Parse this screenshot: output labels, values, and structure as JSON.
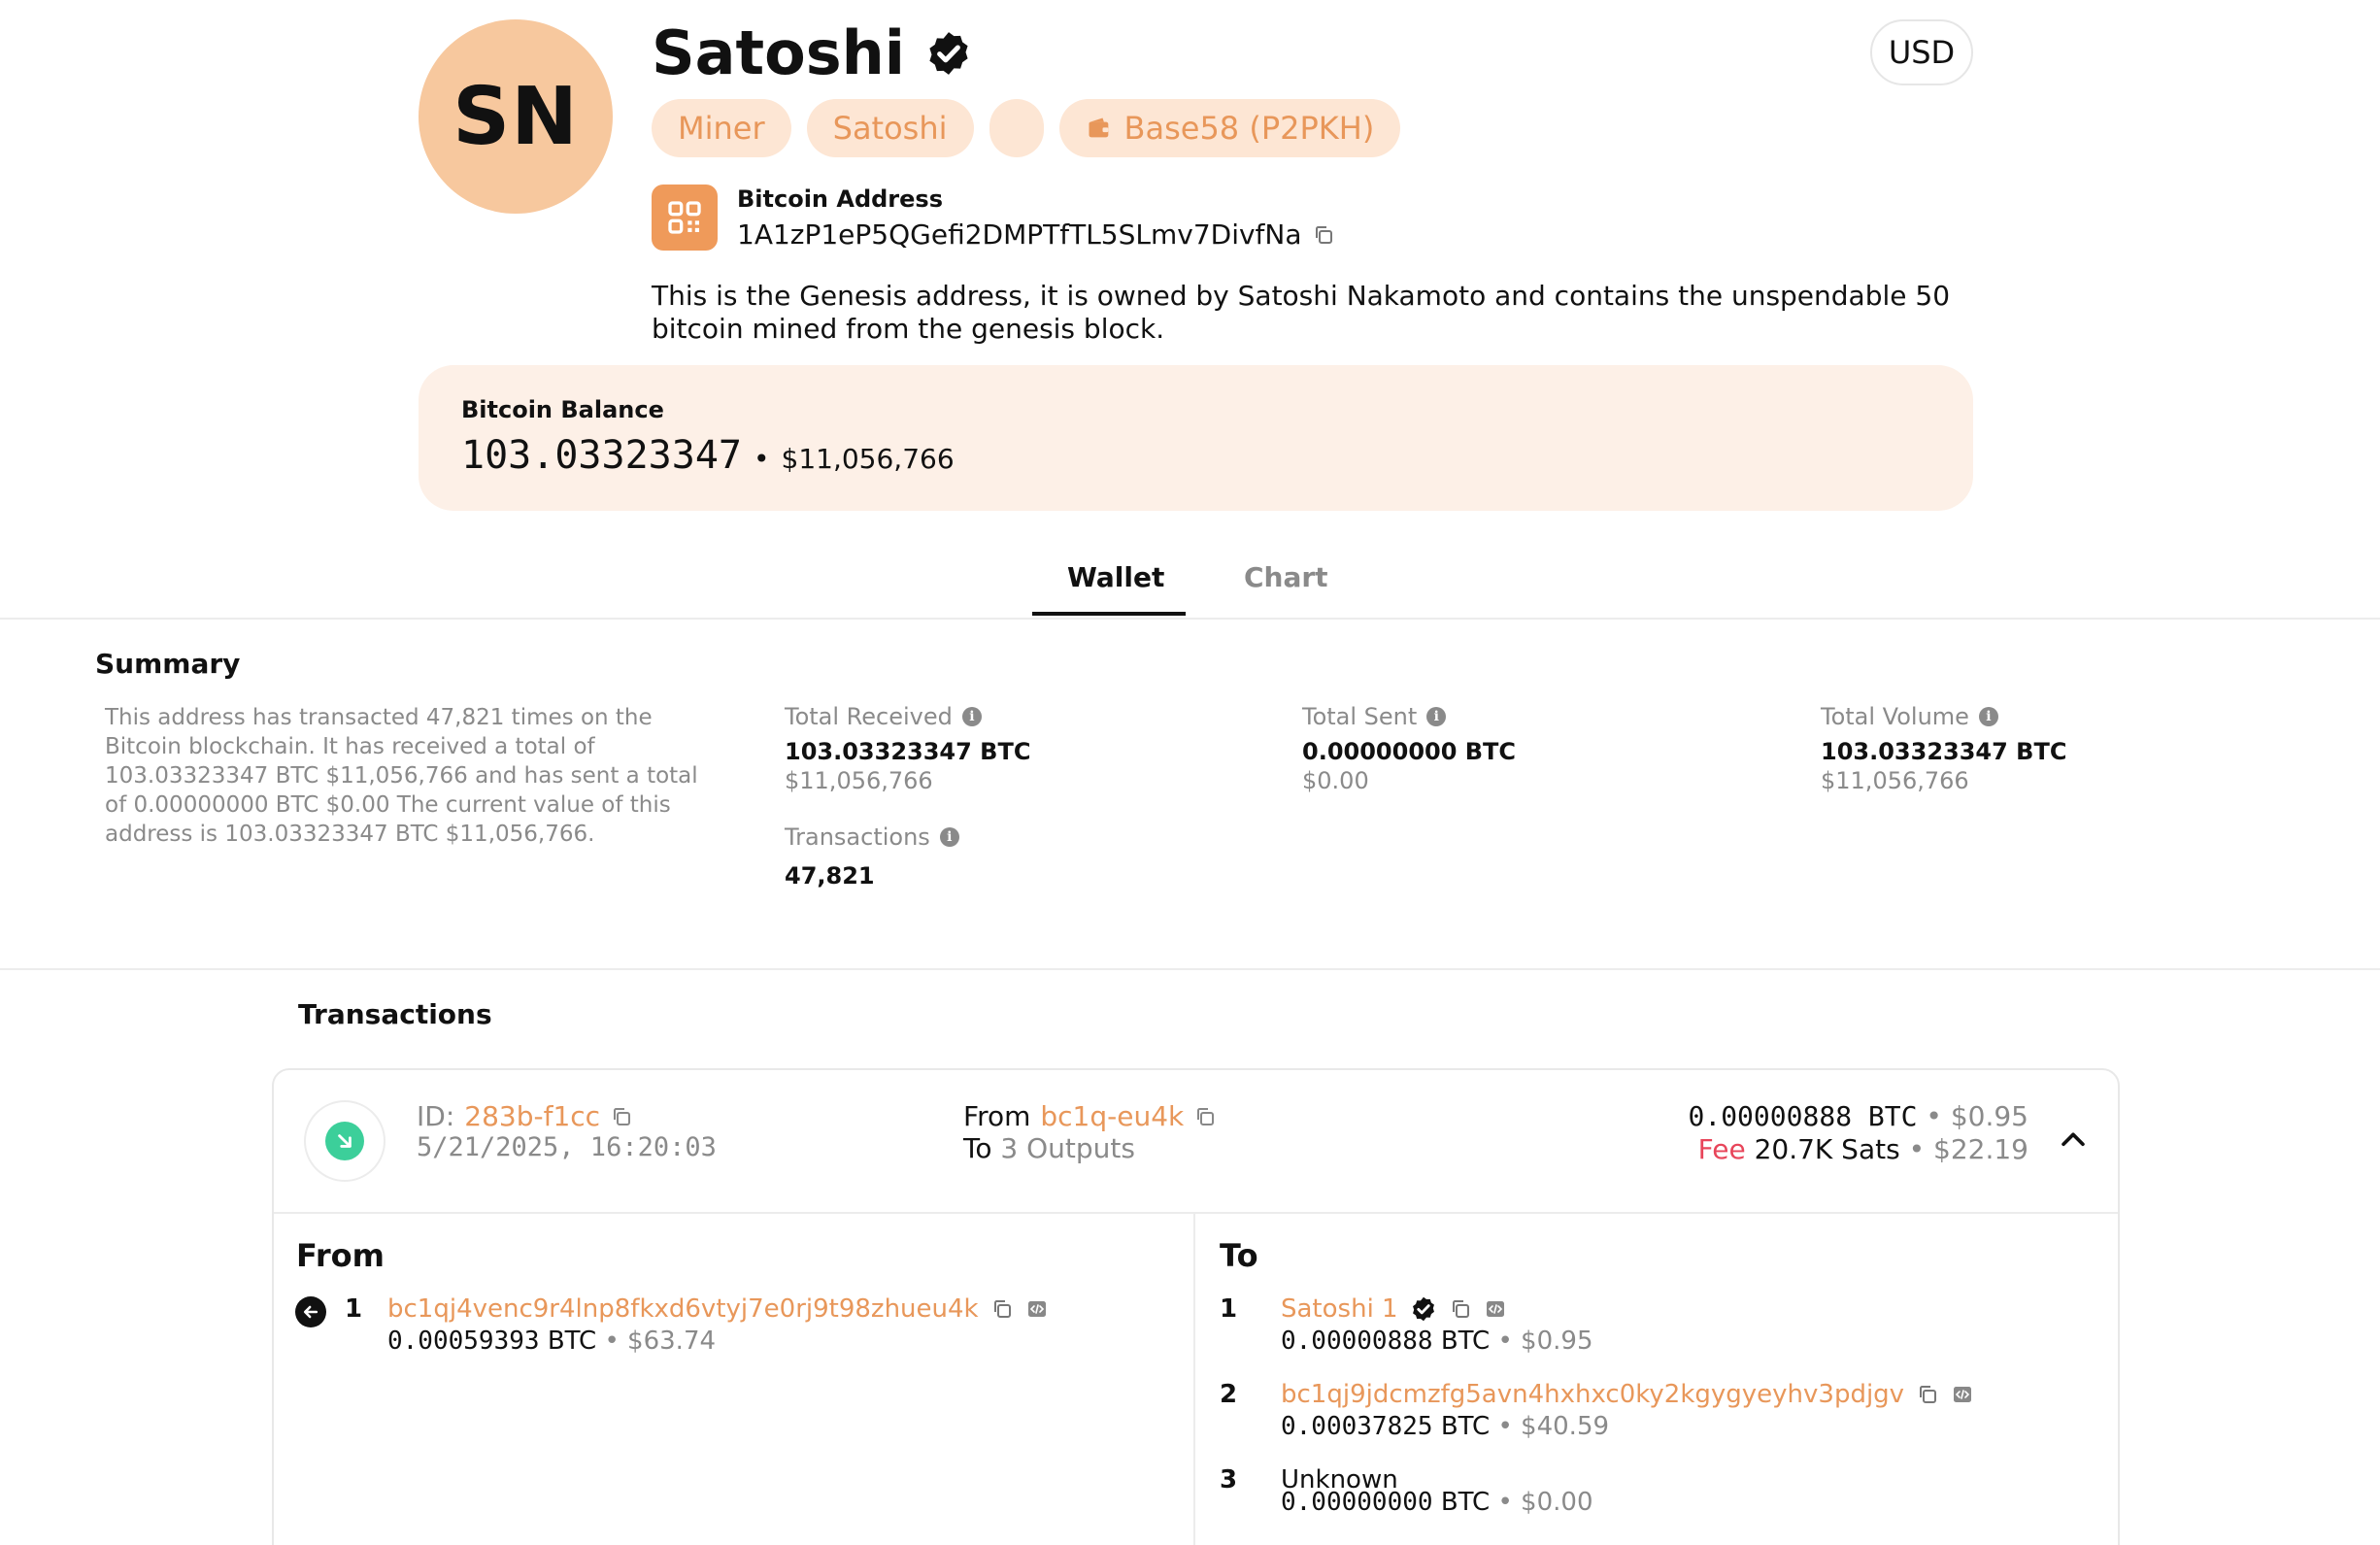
{
  "profile": {
    "initials": "SN",
    "name": "Satoshi",
    "currency": "USD",
    "tags": [
      "Miner",
      "Satoshi",
      "",
      "Base58 (P2PKH)"
    ],
    "address_label": "Bitcoin Address",
    "address": "1A1zP1eP5QGefi2DMPTfTL5SLmv7DivfNa",
    "description": "This is the Genesis address, it is owned by Satoshi Nakamoto and contains the unspendable 50 bitcoin mined from the genesis block."
  },
  "balance": {
    "label": "Bitcoin Balance",
    "btc": "103.03323347",
    "separator": "•",
    "usd": "$11,056,766"
  },
  "tabs": [
    {
      "label": "Wallet",
      "active": true
    },
    {
      "label": "Chart",
      "active": false
    }
  ],
  "summary": {
    "title": "Summary",
    "text": "This address has transacted 47,821 times on the Bitcoin blockchain. It has received a total of 103.03323347 BTC $11,056,766 and has sent a total of 0.00000000 BTC $0.00 The current value of this address is 103.03323347 BTC $11,056,766.",
    "stats": {
      "received": {
        "label": "Total Received",
        "value": "103.03323347 BTC",
        "sub": "$11,056,766"
      },
      "sent": {
        "label": "Total Sent",
        "value": "0.00000000 BTC",
        "sub": "$0.00"
      },
      "volume": {
        "label": "Total Volume",
        "value": "103.03323347 BTC",
        "sub": "$11,056,766"
      },
      "transactions": {
        "label": "Transactions",
        "value": "47,821"
      }
    },
    "info_glyph": "i"
  },
  "transactions": {
    "title": "Transactions",
    "items": [
      {
        "id_label": "ID:",
        "id": "283b-f1cc",
        "date": "5/21/2025, 16:20:03",
        "from_label": "From",
        "from_addr": "bc1q-eu4k",
        "to_label": "To",
        "to_outputs": "3 Outputs",
        "amount": "0.00000888 BTC",
        "amount_usd": "$0.95",
        "fee_label": "Fee",
        "fee": "20.7K Sats",
        "fee_usd": "$22.19",
        "bullet": "•",
        "from_col_title": "From",
        "to_col_title": "To",
        "inputs": [
          {
            "num": "1",
            "address": "bc1qj4venc9r4lnp8fkxd6vtyj7e0rj9t98zhueu4k",
            "btc": "0.00059393",
            "unit": "BTC",
            "usd": "$63.74"
          }
        ],
        "outputs": [
          {
            "num": "1",
            "address": "Satoshi 1",
            "btc": "0.00000888",
            "unit": "BTC",
            "usd": "$0.95"
          },
          {
            "num": "2",
            "address": "bc1qj9jdcmzfg5avn4hxhxc0ky2kgygyeyhv3pdjgv",
            "btc": "0.00037825",
            "unit": "BTC",
            "usd": "$40.59"
          },
          {
            "num": "3",
            "address": "Unknown",
            "btc": "0.00000000",
            "unit": "BTC",
            "usd": "$0.00"
          }
        ]
      }
    ]
  },
  "colors": {
    "accent": "#e8975a",
    "tag_bg": "#fde6d4",
    "avatar_bg": "#f7c89e",
    "balance_bg": "#fdf0e7",
    "incoming": "#3ccf9a",
    "fee": "#e8455a"
  },
  "icons": [
    "verified-badge-icon",
    "wallet-icon",
    "qr-code-icon",
    "copy-icon",
    "info-icon",
    "arrow-down-right-icon",
    "chevron-up-icon",
    "arrow-left-icon",
    "code-icon"
  ]
}
